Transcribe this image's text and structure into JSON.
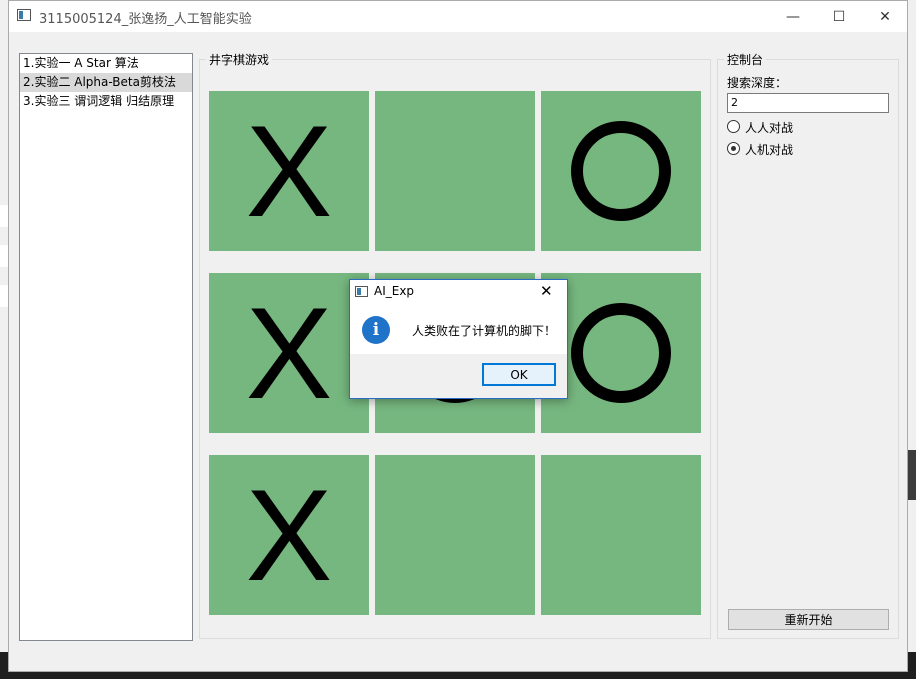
{
  "window": {
    "title": "3115005124_张逸扬_人工智能实验",
    "minimize_glyph": "—",
    "maximize_glyph": "☐",
    "close_glyph": "✕"
  },
  "experiments": [
    {
      "label": "1.实验一  A Star 算法",
      "selected": false
    },
    {
      "label": "2.实验二  Alpha-Beta剪枝法",
      "selected": true
    },
    {
      "label": "3.实验三  谓词逻辑 归结原理",
      "selected": false
    }
  ],
  "game": {
    "title": "井字棋游戏",
    "board": [
      "X",
      "",
      "O",
      "X",
      "O",
      "O",
      "X",
      "",
      ""
    ]
  },
  "control": {
    "title": "控制台",
    "depth_label": "搜索深度：",
    "depth_value": "2",
    "mode_options": [
      "人人对战",
      "人机对战"
    ],
    "selected_mode": "人机对战",
    "restart_label": "重新开始"
  },
  "dialog": {
    "title": "AI_Exp",
    "message": "人类败在了计算机的脚下！",
    "ok_label": "OK",
    "info_glyph": "i",
    "close_glyph": "✕"
  },
  "colors": {
    "cell": "#76b77f",
    "dialog_border": "#2b6cc4",
    "ok_border": "#0078d7"
  }
}
